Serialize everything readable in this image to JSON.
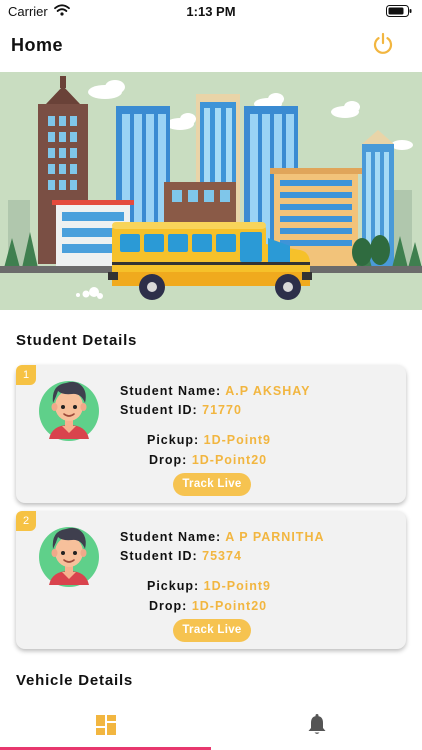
{
  "status_bar": {
    "carrier": "Carrier",
    "time": "1:13 PM"
  },
  "header": {
    "title": "Home",
    "power_icon": "power-icon"
  },
  "hero": {
    "image": "city-school-bus-illustration"
  },
  "students_section": {
    "title": "Student Details",
    "students": [
      {
        "index": "1",
        "name_label": "Student Name:",
        "name": "A.P AKSHAY",
        "id_label": "Student ID:",
        "id": "71770",
        "pickup_label": "Pickup:",
        "pickup": "1D-Point9",
        "drop_label": "Drop:",
        "drop": "1D-Point20",
        "track_label": "Track Live"
      },
      {
        "index": "2",
        "name_label": "Student Name:",
        "name": "A P PARNITHA",
        "id_label": "Student ID:",
        "id": "75374",
        "pickup_label": "Pickup:",
        "pickup": "1D-Point9",
        "drop_label": "Drop:",
        "drop": "1D-Point20",
        "track_label": "Track Live"
      }
    ]
  },
  "vehicle_section": {
    "title": "Vehicle Details"
  },
  "bottom_nav": {
    "items": [
      {
        "icon": "dashboard-icon",
        "active": true
      },
      {
        "icon": "bell-icon",
        "active": false
      }
    ]
  },
  "colors": {
    "accent_yellow": "#f2b640",
    "button_yellow": "#f6c350",
    "active_tab": "#e8386e",
    "card_bg": "#f2f2f2"
  }
}
